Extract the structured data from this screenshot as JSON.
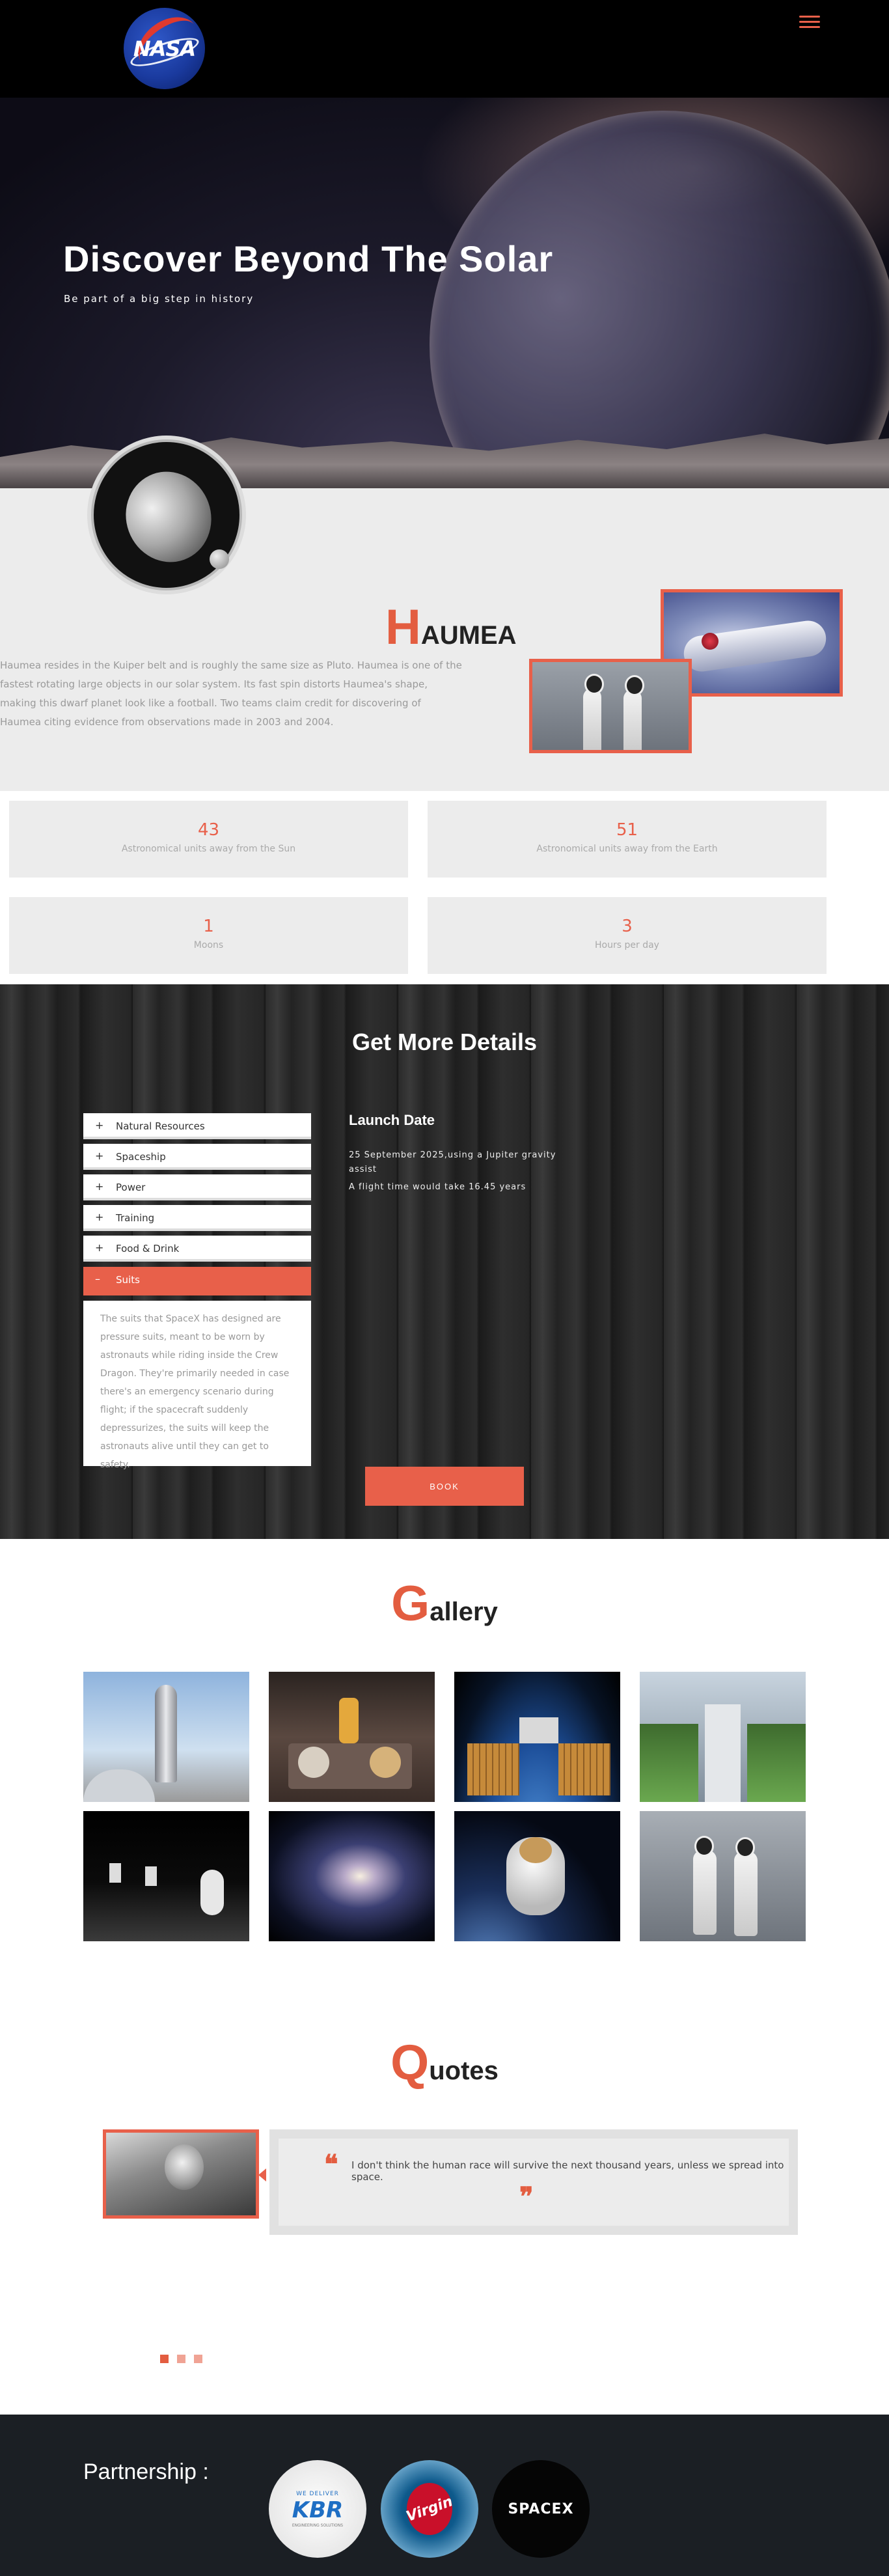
{
  "header": {
    "logo_text": "NASA"
  },
  "hero": {
    "title": "Discover Beyond The Solar",
    "subtitle": "Be part of a big step in history"
  },
  "haumea": {
    "heading_first": "H",
    "heading_rest": "AUMEA",
    "text": "Haumea resides in the Kuiper belt and is roughly the same size as Pluto. Haumea is one of the fastest rotating large objects in our solar system. Its fast spin distorts Haumea's shape, making this dwarf planet look like a football. Two teams claim credit for discovering of Haumea citing evidence from observations made in 2003 and 2004."
  },
  "stats": [
    {
      "value": "43",
      "label": "Astronomical units away from the Sun"
    },
    {
      "value": "51",
      "label": "Astronomical units away from the Earth"
    },
    {
      "value": "1",
      "label": "Moons"
    },
    {
      "value": "3",
      "label": "Hours per day"
    }
  ],
  "details": {
    "title": "Get More Details",
    "accordion": [
      {
        "icon": "+",
        "label": "Natural Resources"
      },
      {
        "icon": "+",
        "label": "Spaceship"
      },
      {
        "icon": "+",
        "label": "Power"
      },
      {
        "icon": "+",
        "label": "Training"
      },
      {
        "icon": "+",
        "label": "Food & Drink"
      },
      {
        "icon": "–",
        "label": "Suits"
      }
    ],
    "active_panel": "The suits that SpaceX has designed are pressure suits, meant to be worn by astronauts while riding inside the Crew Dragon. They're primarily needed in case there's an emergency scenario during flight; if the spacecraft suddenly depressurizes, the suits will keep the astronauts alive until they can get to safety.",
    "launch_title": "Launch Date",
    "launch_text": "25 September 2025,using a Jupiter gravity assist",
    "flight_text": "A flight time would take 16.45 years",
    "book_label": "BOOK"
  },
  "gallery": {
    "heading_first": "G",
    "heading_rest": "allery",
    "items": [
      "starship",
      "space-food",
      "space-station",
      "space-farm",
      "moon-walk",
      "galaxy",
      "astronaut",
      "suits"
    ]
  },
  "quotes": {
    "heading_first": "Q",
    "heading_rest": "uotes",
    "open_mark": "❝",
    "close_mark": "❞",
    "text": "I don't think the human race will survive the next thousand years, unless we spread into space."
  },
  "footer": {
    "partnership_label": "Partnership :",
    "partners": [
      {
        "name": "KBR",
        "tagline": "WE DELIVER",
        "bottom_text": "ENGINEERING SOLUTIONS"
      },
      {
        "name": "Virgin"
      },
      {
        "name": "SPACEX"
      }
    ]
  },
  "colors": {
    "accent": "#e8604a",
    "dark": "#000000",
    "footer": "#1b1f24",
    "light_panel": "#ececec"
  }
}
